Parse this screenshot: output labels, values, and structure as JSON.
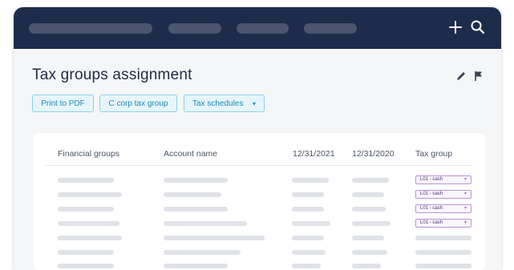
{
  "header": {
    "icons": [
      "plus-icon",
      "search-icon"
    ]
  },
  "page": {
    "title": "Tax groups assignment",
    "right_icons": [
      "pencil-icon",
      "flag-icon"
    ]
  },
  "toolbar": {
    "print_label": "Print to PDF",
    "ccorp_label": "C corp tax group",
    "schedules_label": "Tax schedules"
  },
  "table": {
    "columns": [
      "Financial groups",
      "Account name",
      "12/31/2021",
      "12/31/2020",
      "Tax group"
    ],
    "tax_groups": [
      "L01 - cash",
      "L01 - cash",
      "L01 - cash",
      "L01 - cash"
    ]
  },
  "colors": {
    "topbar": "#1c2c4a",
    "accent": "#1a8ab8",
    "tax_group_border": "#b794d6"
  }
}
